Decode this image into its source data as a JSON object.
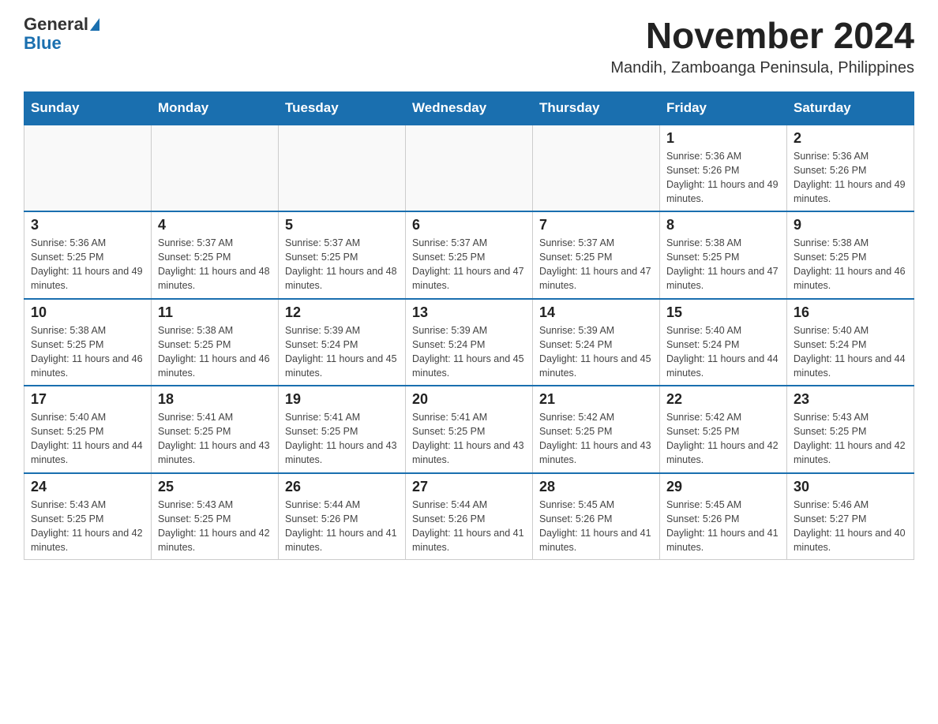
{
  "header": {
    "logo_general": "General",
    "logo_blue": "Blue",
    "month_year": "November 2024",
    "location": "Mandih, Zamboanga Peninsula, Philippines"
  },
  "days_of_week": [
    "Sunday",
    "Monday",
    "Tuesday",
    "Wednesday",
    "Thursday",
    "Friday",
    "Saturday"
  ],
  "weeks": [
    [
      {
        "day": "",
        "info": ""
      },
      {
        "day": "",
        "info": ""
      },
      {
        "day": "",
        "info": ""
      },
      {
        "day": "",
        "info": ""
      },
      {
        "day": "",
        "info": ""
      },
      {
        "day": "1",
        "info": "Sunrise: 5:36 AM\nSunset: 5:26 PM\nDaylight: 11 hours and 49 minutes."
      },
      {
        "day": "2",
        "info": "Sunrise: 5:36 AM\nSunset: 5:26 PM\nDaylight: 11 hours and 49 minutes."
      }
    ],
    [
      {
        "day": "3",
        "info": "Sunrise: 5:36 AM\nSunset: 5:25 PM\nDaylight: 11 hours and 49 minutes."
      },
      {
        "day": "4",
        "info": "Sunrise: 5:37 AM\nSunset: 5:25 PM\nDaylight: 11 hours and 48 minutes."
      },
      {
        "day": "5",
        "info": "Sunrise: 5:37 AM\nSunset: 5:25 PM\nDaylight: 11 hours and 48 minutes."
      },
      {
        "day": "6",
        "info": "Sunrise: 5:37 AM\nSunset: 5:25 PM\nDaylight: 11 hours and 47 minutes."
      },
      {
        "day": "7",
        "info": "Sunrise: 5:37 AM\nSunset: 5:25 PM\nDaylight: 11 hours and 47 minutes."
      },
      {
        "day": "8",
        "info": "Sunrise: 5:38 AM\nSunset: 5:25 PM\nDaylight: 11 hours and 47 minutes."
      },
      {
        "day": "9",
        "info": "Sunrise: 5:38 AM\nSunset: 5:25 PM\nDaylight: 11 hours and 46 minutes."
      }
    ],
    [
      {
        "day": "10",
        "info": "Sunrise: 5:38 AM\nSunset: 5:25 PM\nDaylight: 11 hours and 46 minutes."
      },
      {
        "day": "11",
        "info": "Sunrise: 5:38 AM\nSunset: 5:25 PM\nDaylight: 11 hours and 46 minutes."
      },
      {
        "day": "12",
        "info": "Sunrise: 5:39 AM\nSunset: 5:24 PM\nDaylight: 11 hours and 45 minutes."
      },
      {
        "day": "13",
        "info": "Sunrise: 5:39 AM\nSunset: 5:24 PM\nDaylight: 11 hours and 45 minutes."
      },
      {
        "day": "14",
        "info": "Sunrise: 5:39 AM\nSunset: 5:24 PM\nDaylight: 11 hours and 45 minutes."
      },
      {
        "day": "15",
        "info": "Sunrise: 5:40 AM\nSunset: 5:24 PM\nDaylight: 11 hours and 44 minutes."
      },
      {
        "day": "16",
        "info": "Sunrise: 5:40 AM\nSunset: 5:24 PM\nDaylight: 11 hours and 44 minutes."
      }
    ],
    [
      {
        "day": "17",
        "info": "Sunrise: 5:40 AM\nSunset: 5:25 PM\nDaylight: 11 hours and 44 minutes."
      },
      {
        "day": "18",
        "info": "Sunrise: 5:41 AM\nSunset: 5:25 PM\nDaylight: 11 hours and 43 minutes."
      },
      {
        "day": "19",
        "info": "Sunrise: 5:41 AM\nSunset: 5:25 PM\nDaylight: 11 hours and 43 minutes."
      },
      {
        "day": "20",
        "info": "Sunrise: 5:41 AM\nSunset: 5:25 PM\nDaylight: 11 hours and 43 minutes."
      },
      {
        "day": "21",
        "info": "Sunrise: 5:42 AM\nSunset: 5:25 PM\nDaylight: 11 hours and 43 minutes."
      },
      {
        "day": "22",
        "info": "Sunrise: 5:42 AM\nSunset: 5:25 PM\nDaylight: 11 hours and 42 minutes."
      },
      {
        "day": "23",
        "info": "Sunrise: 5:43 AM\nSunset: 5:25 PM\nDaylight: 11 hours and 42 minutes."
      }
    ],
    [
      {
        "day": "24",
        "info": "Sunrise: 5:43 AM\nSunset: 5:25 PM\nDaylight: 11 hours and 42 minutes."
      },
      {
        "day": "25",
        "info": "Sunrise: 5:43 AM\nSunset: 5:25 PM\nDaylight: 11 hours and 42 minutes."
      },
      {
        "day": "26",
        "info": "Sunrise: 5:44 AM\nSunset: 5:26 PM\nDaylight: 11 hours and 41 minutes."
      },
      {
        "day": "27",
        "info": "Sunrise: 5:44 AM\nSunset: 5:26 PM\nDaylight: 11 hours and 41 minutes."
      },
      {
        "day": "28",
        "info": "Sunrise: 5:45 AM\nSunset: 5:26 PM\nDaylight: 11 hours and 41 minutes."
      },
      {
        "day": "29",
        "info": "Sunrise: 5:45 AM\nSunset: 5:26 PM\nDaylight: 11 hours and 41 minutes."
      },
      {
        "day": "30",
        "info": "Sunrise: 5:46 AM\nSunset: 5:27 PM\nDaylight: 11 hours and 40 minutes."
      }
    ]
  ]
}
